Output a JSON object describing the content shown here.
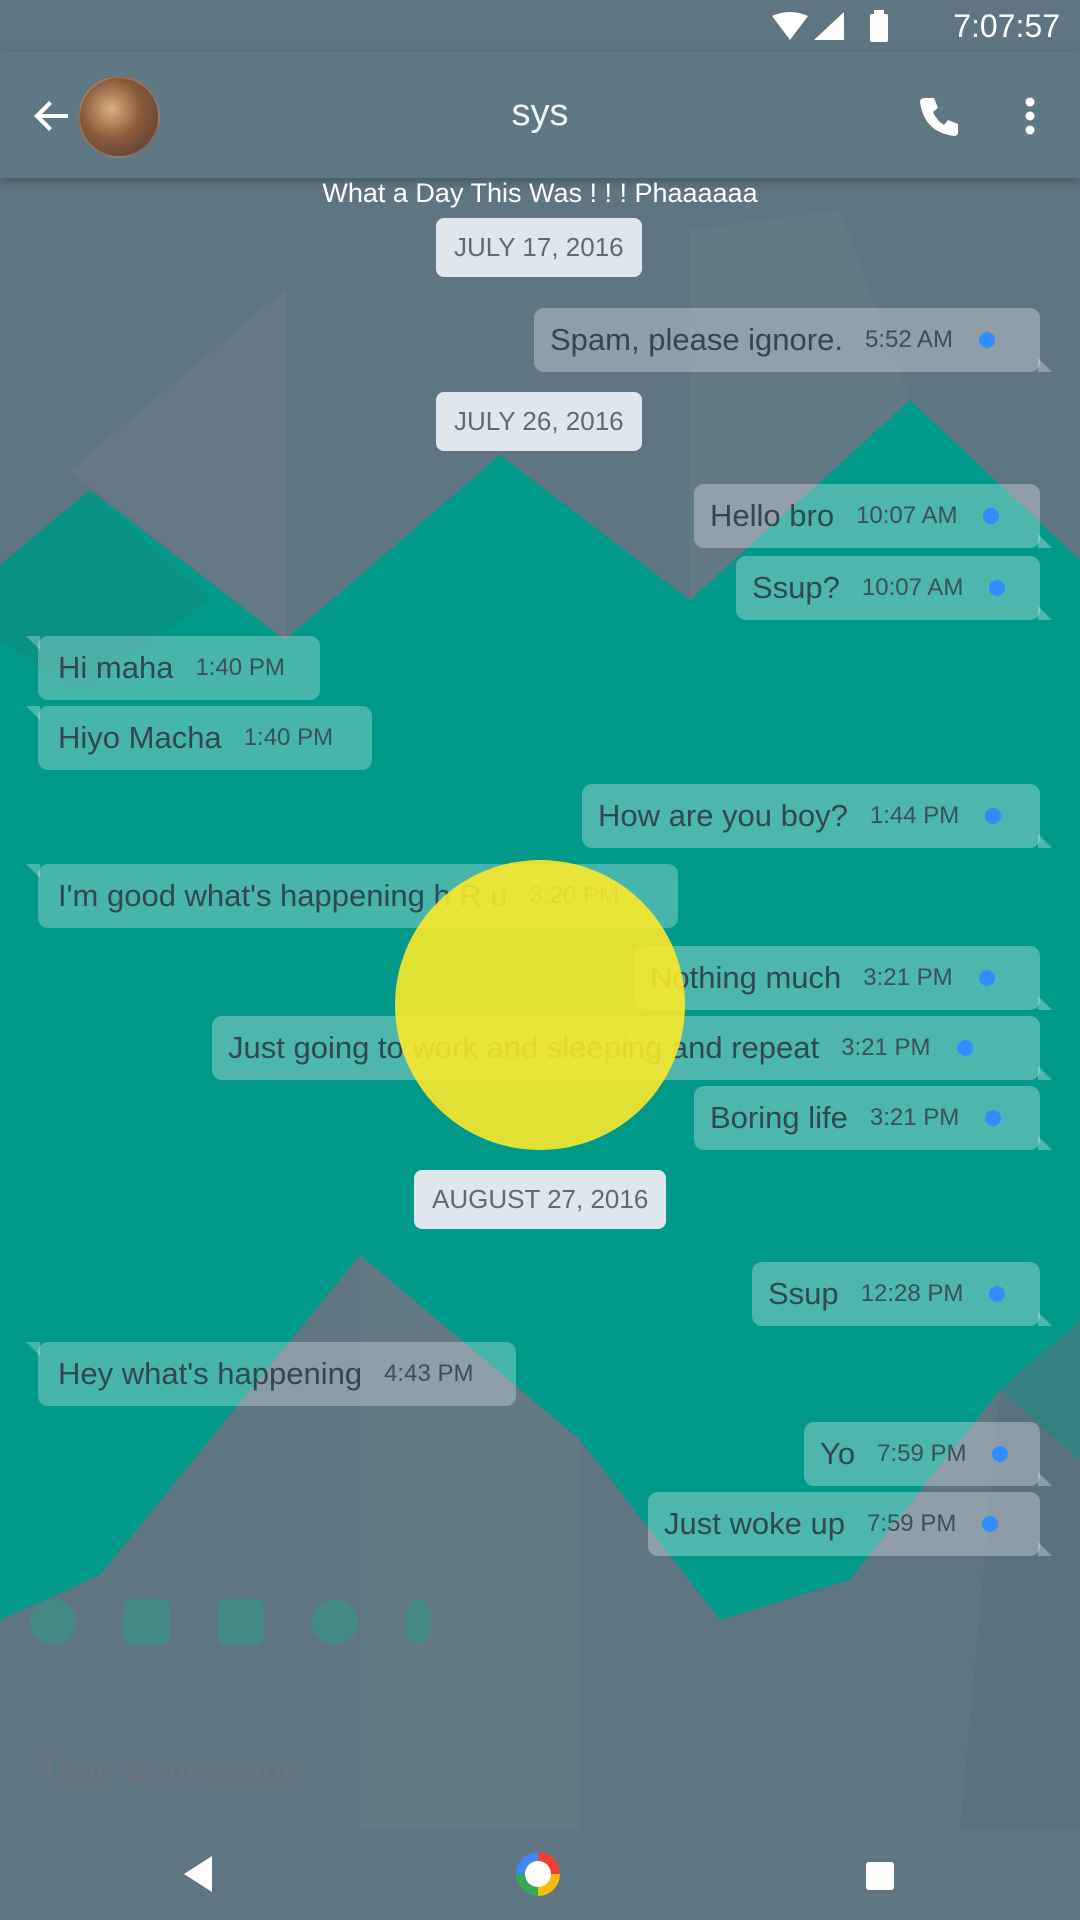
{
  "status_bar": {
    "time": "7:07:57"
  },
  "toolbar": {
    "title": "sys"
  },
  "contact_status": "What a Day This Was ! ! ! Phaaaaaa",
  "date_separators": [
    "JULY 17, 2016",
    "JULY 26, 2016",
    "AUGUST 27, 2016"
  ],
  "messages": [
    {
      "dir": "out",
      "text": "Spam, please ignore.",
      "time": "5:52 AM"
    },
    {
      "dir": "out",
      "text": "Hello bro",
      "time": "10:07 AM"
    },
    {
      "dir": "out",
      "text": "Ssup?",
      "time": "10:07 AM"
    },
    {
      "dir": "in",
      "text": "Hi maha",
      "time": "1:40 PM"
    },
    {
      "dir": "in",
      "text": "Hiyo Macha",
      "time": "1:40 PM"
    },
    {
      "dir": "out",
      "text": "How are you boy?",
      "time": "1:44 PM"
    },
    {
      "dir": "in",
      "text": "I'm good  what's happening h R u",
      "time": "3:20 PM"
    },
    {
      "dir": "out",
      "text": "Nothing much",
      "time": "3:21 PM"
    },
    {
      "dir": "out",
      "text": "Just going to work and sleeping and repeat",
      "time": "3:21 PM"
    },
    {
      "dir": "out",
      "text": "Boring life",
      "time": "3:21 PM"
    },
    {
      "dir": "out",
      "text": "Ssup",
      "time": "12:28 PM"
    },
    {
      "dir": "in",
      "text": "Hey what's happening",
      "time": "4:43 PM"
    },
    {
      "dir": "out",
      "text": "Yo",
      "time": "7:59 PM"
    },
    {
      "dir": "out",
      "text": "Just woke up",
      "time": "7:59 PM"
    }
  ],
  "composer": {
    "placeholder": "Type a message"
  },
  "colors": {
    "teal": "#00998a",
    "slate": "#5f7682",
    "sent_dot": "#2f8dff",
    "touch": "#ffeb28"
  }
}
